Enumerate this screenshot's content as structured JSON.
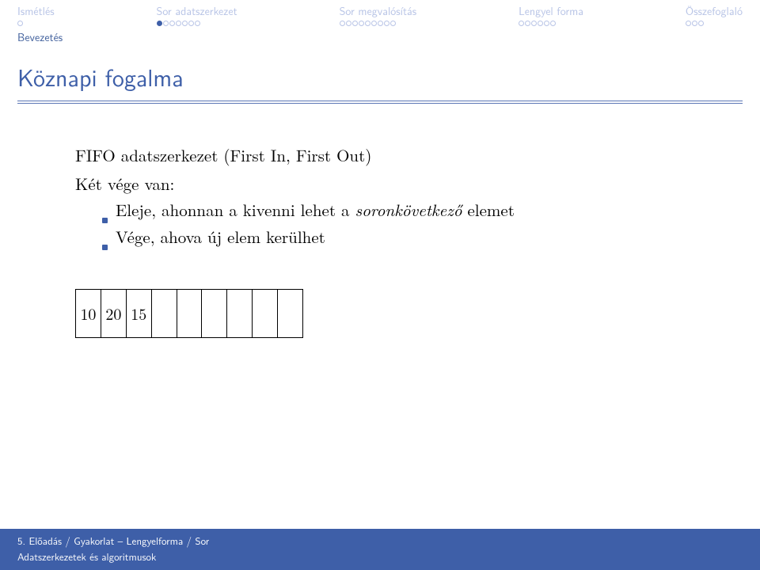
{
  "nav": [
    {
      "label": "Ismétlés",
      "dots": 1,
      "filled": []
    },
    {
      "label": "Sor adatszerkezet",
      "dots": 7,
      "filled": [
        0
      ]
    },
    {
      "label": "Sor megvalósítás",
      "dots": 9,
      "filled": []
    },
    {
      "label": "Lengyel forma",
      "dots": 6,
      "filled": []
    },
    {
      "label": "Összefoglaló",
      "dots": 3,
      "filled": []
    }
  ],
  "subsection": "Bevezetés",
  "title": "Köznapi fogalma",
  "content": {
    "lead": "FIFO adatszerkezet (First In, First Out)",
    "line2": "Két vége van:",
    "items": [
      {
        "pre": "Eleje, ahonnan a kivenni lehet a ",
        "em": "soronkövetkező",
        "post": " elemet"
      },
      {
        "pre": "Vége, ahova új elem kerülhet",
        "em": "",
        "post": ""
      }
    ]
  },
  "queue": [
    "10",
    "20",
    "15",
    "",
    "",
    "",
    "",
    "",
    ""
  ],
  "footer": {
    "line1": "5. Előadás / Gyakorlat – Lengyelforma / Sor",
    "line2": "Adatszerkezetek és algoritmusok"
  }
}
